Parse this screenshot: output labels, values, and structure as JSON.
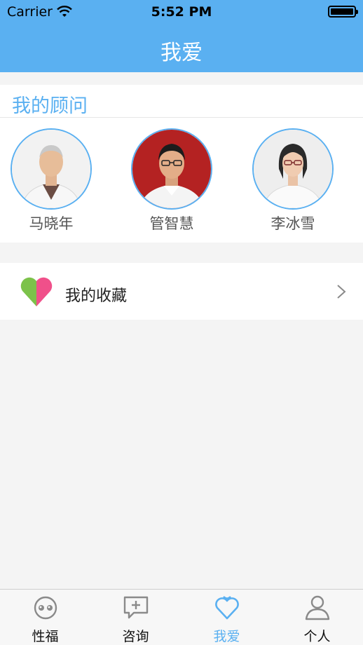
{
  "status_bar": {
    "carrier": "Carrier",
    "time": "5:52 PM"
  },
  "nav": {
    "title": "我爱"
  },
  "advisors": {
    "section_title": "我的顾问",
    "items": [
      {
        "name": "马晓年"
      },
      {
        "name": "管智慧"
      },
      {
        "name": "李冰雪"
      }
    ]
  },
  "favorites": {
    "label": "我的收藏",
    "icon": "heart-icon"
  },
  "tabbar": {
    "items": [
      {
        "label": "性福",
        "icon": "smile-face-icon"
      },
      {
        "label": "咨询",
        "icon": "chat-plus-icon"
      },
      {
        "label": "我爱",
        "icon": "heart-outline-icon",
        "active": true
      },
      {
        "label": "个人",
        "icon": "person-icon"
      }
    ]
  },
  "colors": {
    "accent": "#5ab0f1",
    "background": "#f4f4f4",
    "heart_green": "#7cc24a",
    "heart_pink": "#f0508a"
  }
}
